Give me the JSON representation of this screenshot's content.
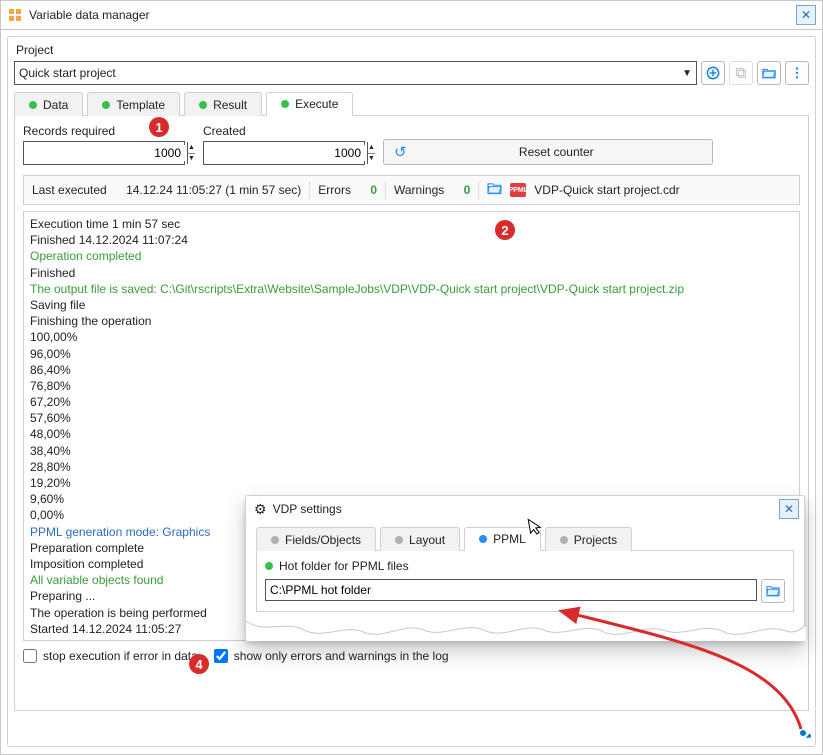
{
  "window": {
    "title": "Variable data manager"
  },
  "project": {
    "label": "Project",
    "selected": "Quick start project"
  },
  "main_tabs": {
    "data": "Data",
    "template": "Template",
    "result": "Result",
    "execute": "Execute"
  },
  "execute": {
    "records_label": "Records required",
    "records_value": "1000",
    "created_label": "Created",
    "created_value": "1000",
    "reset_label": "Reset counter"
  },
  "infobar": {
    "last_executed_label": "Last executed",
    "last_executed_value": "14.12.24 11:05:27 (1 min 57 sec)",
    "errors_label": "Errors",
    "errors_count": "0",
    "warnings_label": "Warnings",
    "warnings_count": "0",
    "file_name": "VDP-Quick start project.cdr"
  },
  "log_lines": [
    {
      "t": "Execution time 1 min 57 sec",
      "c": ""
    },
    {
      "t": "Finished 14.12.2024 11:07:24",
      "c": ""
    },
    {
      "t": "Operation completed",
      "c": "log-green"
    },
    {
      "t": "Finished",
      "c": ""
    },
    {
      "t": "The output file is saved: C:\\Git\\rscripts\\Extra\\Website\\SampleJobs\\VDP\\VDP-Quick start project\\VDP-Quick start project.zip",
      "c": "log-green"
    },
    {
      "t": "Saving file",
      "c": ""
    },
    {
      "t": "Finishing the operation",
      "c": ""
    },
    {
      "t": "100,00%",
      "c": ""
    },
    {
      "t": "96,00%",
      "c": ""
    },
    {
      "t": "86,40%",
      "c": ""
    },
    {
      "t": "76,80%",
      "c": ""
    },
    {
      "t": "67,20%",
      "c": ""
    },
    {
      "t": "57,60%",
      "c": ""
    },
    {
      "t": "48,00%",
      "c": ""
    },
    {
      "t": "38,40%",
      "c": ""
    },
    {
      "t": "28,80%",
      "c": ""
    },
    {
      "t": "19,20%",
      "c": ""
    },
    {
      "t": "9,60%",
      "c": ""
    },
    {
      "t": "0,00%",
      "c": ""
    },
    {
      "t": "PPML generation mode: Graphics",
      "c": "log-blue"
    },
    {
      "t": "Preparation complete",
      "c": ""
    },
    {
      "t": "Imposition completed",
      "c": ""
    },
    {
      "t": "All variable objects found",
      "c": "log-green"
    },
    {
      "t": "Preparing ...",
      "c": ""
    },
    {
      "t": "The operation is being performed",
      "c": ""
    },
    {
      "t": "Started 14.12.2024 11:05:27",
      "c": ""
    }
  ],
  "checks": {
    "stop_on_error": "stop execution if error in data",
    "only_errors": "show only errors and warnings in the log"
  },
  "popup": {
    "title": "VDP settings",
    "tabs": {
      "fields": "Fields/Objects",
      "layout": "Layout",
      "ppml": "PPML",
      "projects": "Projects"
    },
    "hot_folder_label": "Hot folder for PPML files",
    "hot_folder_path": "C:\\PPML hot folder"
  },
  "badges": {
    "b1": "1",
    "b2": "2",
    "b4": "4"
  },
  "icons": {
    "ppml_badge_text": "PPML"
  }
}
